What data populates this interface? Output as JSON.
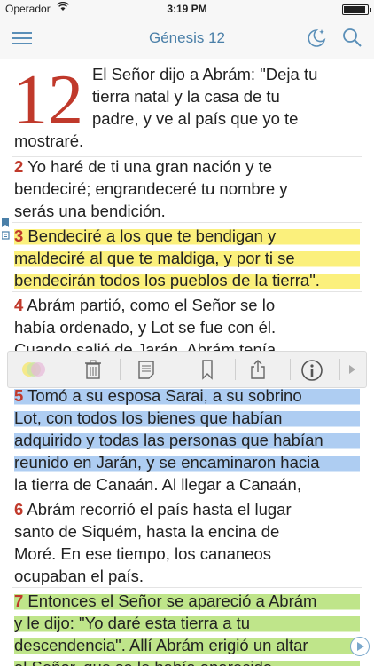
{
  "status": {
    "carrier": "Operador",
    "time": "3:19 PM"
  },
  "nav": {
    "title": "Génesis 12"
  },
  "chapter": "12",
  "verses": [
    {
      "num": "",
      "lines": [
        "El Señor dijo a Abrám: \"Deja tu",
        "tierra natal y la casa de tu",
        "padre, y ve al país que yo te",
        "mostraré."
      ]
    },
    {
      "num": "2",
      "lines": [
        " Yo haré de ti una gran nación y te",
        "bendeciré; engrandeceré tu nombre y",
        "serás una bendición."
      ]
    },
    {
      "num": "3",
      "lines": [
        " Bendeciré a los que te bendigan y",
        "maldeciré al que te maldiga, y por ti se",
        "bendecirán todos los pueblos de la tierra\"."
      ]
    },
    {
      "num": "4",
      "lines": [
        " Abrám partió, como el Señor se lo",
        "había ordenado, y Lot se fue con él.",
        "Cuando salió de Jarán, Abrám tenía"
      ]
    },
    {
      "num": "5",
      "lines": [
        " Tomó a su esposa Sarai, a su sobrino",
        "Lot, con todos los bienes que habían",
        "adquirido y todas las personas que habían",
        "reunido en Jarán, y se encaminaron hacia",
        "la tierra de Canaán. Al llegar a Canaán,"
      ]
    },
    {
      "num": "6",
      "lines": [
        " Abrám recorrió el país hasta el lugar",
        "santo de Siquém, hasta la encina de",
        "Moré. En ese tiempo, los cananeos",
        "ocupaban el país."
      ]
    },
    {
      "num": "7",
      "lines": [
        " Entonces el Señor se apareció a Abrám",
        "y le dijo: \"Yo daré esta tierra a tu",
        "descendencia\". Allí Abrám erigió un altar",
        "al Señor, que se le había aparecido."
      ]
    }
  ],
  "colors": {
    "accent": "#4a7fa8",
    "verse_number": "#c0392b",
    "highlight_yellow": "#fbf07c",
    "highlight_blue": "#aecdf2",
    "highlight_green": "#bfe58a"
  },
  "toolbar_icons": [
    "color-palette-icon",
    "trash-icon",
    "note-icon",
    "bookmark-icon",
    "share-icon",
    "info-icon",
    "arrow-right-icon"
  ]
}
